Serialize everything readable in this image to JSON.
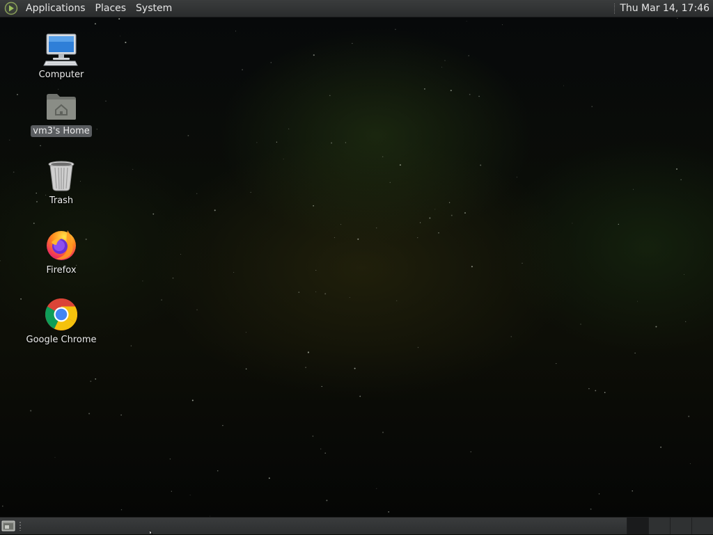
{
  "top_panel": {
    "menus": [
      "Applications",
      "Places",
      "System"
    ],
    "clock": "Thu Mar 14, 17:46"
  },
  "desktop": {
    "icons": [
      {
        "label": "Computer",
        "icon": "computer-icon"
      },
      {
        "label": "vm3's Home",
        "icon": "home-folder-icon",
        "selected": true
      },
      {
        "label": "Trash",
        "icon": "trash-icon"
      },
      {
        "label": "Firefox",
        "icon": "firefox-icon"
      },
      {
        "label": "Google Chrome",
        "icon": "chrome-icon"
      }
    ]
  },
  "bottom_panel": {
    "show_desktop_icon": "show-desktop-icon",
    "workspace_count": 4,
    "active_workspace": 1
  },
  "colors": {
    "panel": "#2f3132",
    "selection": "#5a5d60",
    "text": "#e6e6e6"
  }
}
